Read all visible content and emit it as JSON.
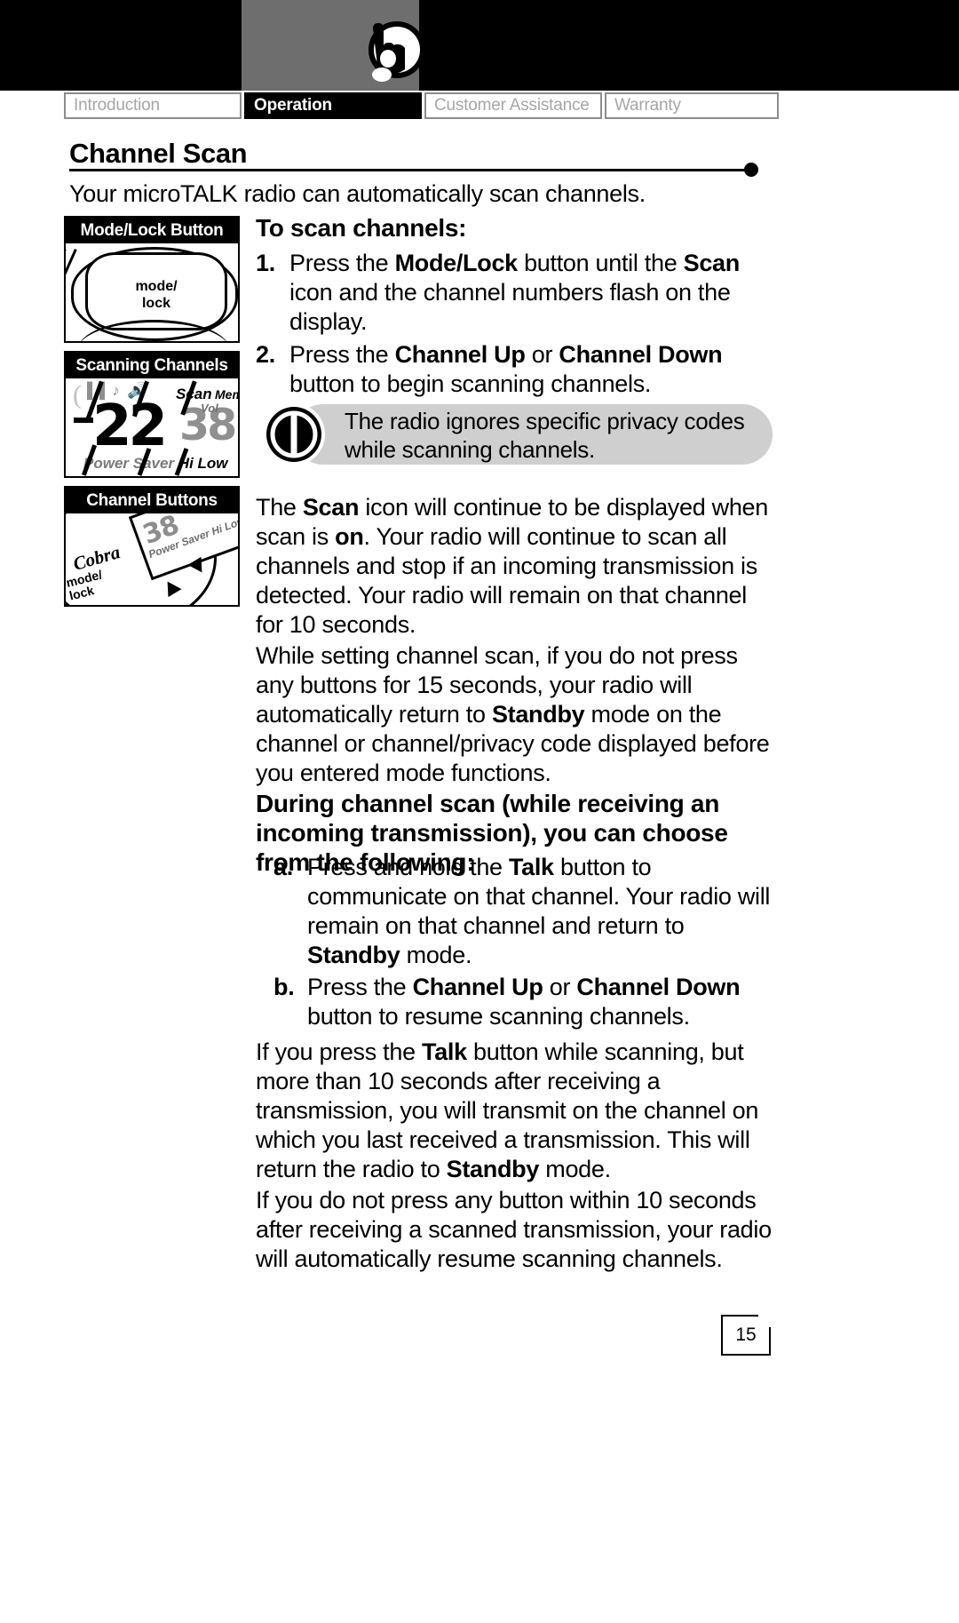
{
  "header": {
    "logo_name": "cobra-walkie-talkie-logo"
  },
  "tabs": [
    {
      "label": "Introduction",
      "active": false
    },
    {
      "label": "Operation",
      "active": true
    },
    {
      "label": "Customer Assistance",
      "active": false
    },
    {
      "label": "Warranty",
      "active": false
    }
  ],
  "section": {
    "title": "Channel Scan",
    "intro": "Your microTALK radio can automatically scan channels."
  },
  "figures": [
    {
      "caption": "Mode/Lock Button",
      "button_label_line1": "mode/",
      "button_label_line2": "lock"
    },
    {
      "caption": "Scanning Channels",
      "lcd": {
        "icon_row": "▐▐ ♪ 🔊",
        "channel": "22",
        "code": "38",
        "scan_label": "Scan",
        "mem_label": "Mem",
        "vol_label": "Vol",
        "bottom_left": "Power Saver",
        "bottom_right": "Hi Low"
      }
    },
    {
      "caption": "Channel Buttons",
      "brand": "Cobra",
      "lcd_digits": "38",
      "lcd_small": "Power Saver  Hi Low  RX TX  Mem",
      "mode_label_line1": "mode/",
      "mode_label_line2": "lock"
    }
  ],
  "content": {
    "to_scan_heading": "To scan channels:",
    "step1": {
      "num": "1.",
      "parts": [
        {
          "t": "Press the ",
          "b": false
        },
        {
          "t": "Mode/Lock",
          "b": true
        },
        {
          "t": " button until the ",
          "b": false
        },
        {
          "t": "Scan",
          "b": true
        },
        {
          "t": " icon and the channel numbers flash on the display.",
          "b": false
        }
      ]
    },
    "step2": {
      "num": "2.",
      "parts": [
        {
          "t": "Press the ",
          "b": false
        },
        {
          "t": "Channel Up",
          "b": true
        },
        {
          "t": " or ",
          "b": false
        },
        {
          "t": "Channel Down",
          "b": true
        },
        {
          "t": " button to begin scanning channels.",
          "b": false
        }
      ]
    },
    "tip": {
      "icon_name": "power-button-icon",
      "text": "The radio ignores specific privacy codes while scanning channels."
    },
    "para_scan_on": {
      "parts": [
        {
          "t": "The ",
          "b": false
        },
        {
          "t": "Scan",
          "b": true
        },
        {
          "t": " icon will continue to be displayed when scan is ",
          "b": false
        },
        {
          "t": "on",
          "b": true
        },
        {
          "t": ". Your radio will continue to scan all channels and stop if an incoming transmission is detected. Your radio will remain on that channel for 10 seconds.",
          "b": false
        }
      ]
    },
    "para_timeout": {
      "parts": [
        {
          "t": "While setting channel scan, if you do not press any buttons for 15 seconds, your radio will automatically return to ",
          "b": false
        },
        {
          "t": "Standby",
          "b": true
        },
        {
          "t": " mode on the channel or channel/privacy code displayed before you entered mode functions.",
          "b": false
        }
      ]
    },
    "during_heading": "During channel scan (while receiving an incoming transmission), you can choose from the following:",
    "item_a": {
      "num": "a.",
      "parts": [
        {
          "t": "Press and hold the ",
          "b": false
        },
        {
          "t": "Talk",
          "b": true
        },
        {
          "t": " button to communicate on that channel. Your radio will remain on that channel and return to ",
          "b": false
        },
        {
          "t": "Standby",
          "b": true
        },
        {
          "t": " mode.",
          "b": false
        }
      ]
    },
    "item_b": {
      "num": "b.",
      "parts": [
        {
          "t": "Press the ",
          "b": false
        },
        {
          "t": "Channel Up",
          "b": true
        },
        {
          "t": " or ",
          "b": false
        },
        {
          "t": "Channel Down",
          "b": true
        },
        {
          "t": " button to resume scanning channels.",
          "b": false
        }
      ]
    },
    "para_talk": {
      "parts": [
        {
          "t": "If you press the ",
          "b": false
        },
        {
          "t": "Talk",
          "b": true
        },
        {
          "t": " button while scanning, but more than 10 seconds after receiving a transmission, you will transmit on the channel on which you last received a transmission. This will return the radio to ",
          "b": false
        },
        {
          "t": "Standby",
          "b": true
        },
        {
          "t": " mode.",
          "b": false
        }
      ]
    },
    "para_resume": {
      "parts": [
        {
          "t": "If you do not press any button within 10 seconds after receiving a scanned transmission, your radio will automatically resume scanning channels.",
          "b": false
        }
      ]
    }
  },
  "page": {
    "number": "15"
  }
}
